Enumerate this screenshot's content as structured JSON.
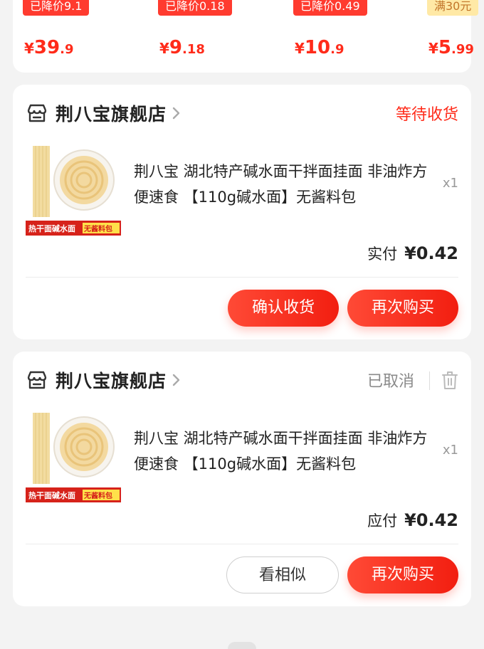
{
  "recommend": {
    "items": [
      {
        "tag": "已降价9.1",
        "currency": "¥",
        "price_int": "39",
        "price_dec": ".9"
      },
      {
        "tag": "已降价0.18",
        "currency": "¥",
        "price_int": "9",
        "price_dec": ".18"
      },
      {
        "tag": "已降价0.49",
        "currency": "¥",
        "price_int": "10",
        "price_dec": ".9"
      },
      {
        "tag": "满30元",
        "currency": "¥",
        "price_int": "5",
        "price_dec": ".99"
      }
    ]
  },
  "orders": [
    {
      "store_name": "荆八宝旗舰店",
      "status": "等待收货",
      "product_title": "荆八宝 湖北特产碱水面干拌面挂面 非油炸方便速食 【110g碱水面】无酱料包",
      "thumb_caption_left": "热干面碱水面",
      "thumb_caption_right": "无酱料包",
      "quantity": "x1",
      "pay_label": "实付",
      "pay_amount": "¥0.42",
      "buttons": {
        "primary_left": "确认收货",
        "primary_right": "再次购买"
      }
    },
    {
      "store_name": "荆八宝旗舰店",
      "status": "已取消",
      "product_title": "荆八宝 湖北特产碱水面干拌面挂面 非油炸方便速食 【110g碱水面】无酱料包",
      "thumb_caption_left": "热干面碱水面",
      "thumb_caption_right": "无酱料包",
      "quantity": "x1",
      "pay_label": "应付",
      "pay_amount": "¥0.42",
      "buttons": {
        "secondary": "看相似",
        "primary_right": "再次购买"
      }
    }
  ],
  "icons": {
    "store": "store-icon",
    "chevron": "chevron-right-icon",
    "trash": "trash-icon"
  },
  "colors": {
    "accent_red": "#ff2b1a",
    "status_gray": "#8a8a8a"
  }
}
